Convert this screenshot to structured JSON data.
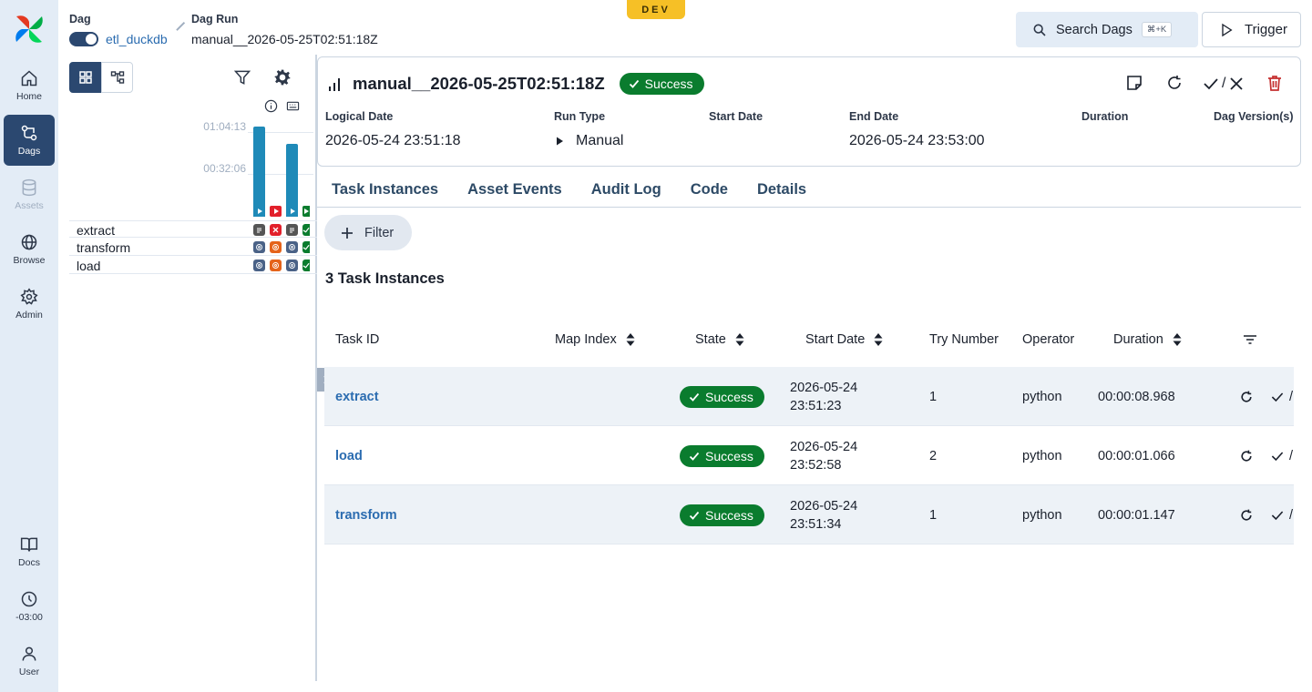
{
  "nav": {
    "items": [
      {
        "label": "Home",
        "icon": "home-icon"
      },
      {
        "label": "Dags",
        "icon": "dags-icon"
      },
      {
        "label": "Assets",
        "icon": "database-icon"
      },
      {
        "label": "Browse",
        "icon": "globe-icon"
      },
      {
        "label": "Admin",
        "icon": "gear-icon"
      }
    ],
    "bottom": [
      {
        "label": "Docs",
        "icon": "book-icon"
      },
      {
        "label": "-03:00",
        "icon": "clock-icon"
      },
      {
        "label": "User",
        "icon": "user-icon"
      }
    ]
  },
  "breadcrumb": {
    "dag_label": "Dag",
    "dag_value": "etl_duckdb",
    "run_label": "Dag Run",
    "run_value": "manual__2026-05-25T02:51:18Z"
  },
  "env_badge": "DEV",
  "search": {
    "label": "Search Dags",
    "shortcut": "⌘+K"
  },
  "trigger": {
    "label": "Trigger"
  },
  "grid": {
    "durations": [
      "01:04:13",
      "00:32:06"
    ],
    "tasks": [
      "extract",
      "transform",
      "load"
    ]
  },
  "run": {
    "title": "manual__2026-05-25T02:51:18Z",
    "state": "Success",
    "action_sep": "/",
    "meta": [
      {
        "label": "Logical Date",
        "value": "2026-05-24 23:51:18"
      },
      {
        "label": "Run Type",
        "value": "Manual"
      },
      {
        "label": "Start Date",
        "value": ""
      },
      {
        "label": "End Date",
        "value": "2026-05-24 23:53:00"
      },
      {
        "label": "Duration",
        "value": ""
      },
      {
        "label": "Dag Version(s)",
        "value": ""
      }
    ]
  },
  "tabs": [
    "Task Instances",
    "Asset Events",
    "Audit Log",
    "Code",
    "Details"
  ],
  "filter_label": "Filter",
  "count_title": "3 Task Instances",
  "table": {
    "columns": [
      "Task ID",
      "Map Index",
      "State",
      "Start Date",
      "Try Number",
      "Operator",
      "Duration"
    ],
    "rows": [
      {
        "task_id": "extract",
        "state": "Success",
        "start_date_1": "2026-05-24",
        "start_date_2": "23:51:23",
        "try": "1",
        "operator": "python",
        "duration": "00:00:08.968"
      },
      {
        "task_id": "load",
        "state": "Success",
        "start_date_1": "2026-05-24",
        "start_date_2": "23:52:58",
        "try": "2",
        "operator": "python",
        "duration": "00:00:01.066"
      },
      {
        "task_id": "transform",
        "state": "Success",
        "start_date_1": "2026-05-24",
        "start_date_2": "23:51:34",
        "try": "1",
        "operator": "python",
        "duration": "00:00:01.147"
      }
    ],
    "action_sep": "/"
  },
  "colors": {
    "success": "#0a7c2e",
    "nav_active": "#2b4870",
    "bar": "#1f8ab8",
    "failed": "#e2202b",
    "env": "#f6c026"
  }
}
